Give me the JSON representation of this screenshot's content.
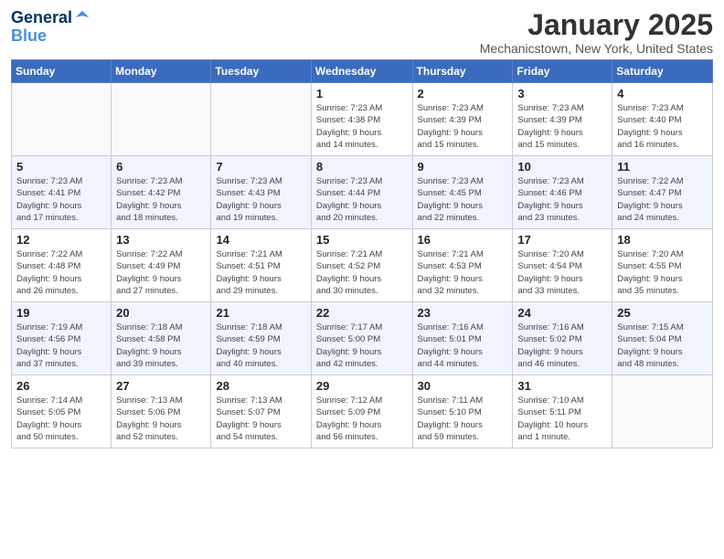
{
  "logo": {
    "line1": "General",
    "line2": "Blue"
  },
  "title": "January 2025",
  "location": "Mechanicstown, New York, United States",
  "weekdays": [
    "Sunday",
    "Monday",
    "Tuesday",
    "Wednesday",
    "Thursday",
    "Friday",
    "Saturday"
  ],
  "weeks": [
    [
      {
        "day": "",
        "info": ""
      },
      {
        "day": "",
        "info": ""
      },
      {
        "day": "",
        "info": ""
      },
      {
        "day": "1",
        "info": "Sunrise: 7:23 AM\nSunset: 4:38 PM\nDaylight: 9 hours\nand 14 minutes."
      },
      {
        "day": "2",
        "info": "Sunrise: 7:23 AM\nSunset: 4:39 PM\nDaylight: 9 hours\nand 15 minutes."
      },
      {
        "day": "3",
        "info": "Sunrise: 7:23 AM\nSunset: 4:39 PM\nDaylight: 9 hours\nand 15 minutes."
      },
      {
        "day": "4",
        "info": "Sunrise: 7:23 AM\nSunset: 4:40 PM\nDaylight: 9 hours\nand 16 minutes."
      }
    ],
    [
      {
        "day": "5",
        "info": "Sunrise: 7:23 AM\nSunset: 4:41 PM\nDaylight: 9 hours\nand 17 minutes."
      },
      {
        "day": "6",
        "info": "Sunrise: 7:23 AM\nSunset: 4:42 PM\nDaylight: 9 hours\nand 18 minutes."
      },
      {
        "day": "7",
        "info": "Sunrise: 7:23 AM\nSunset: 4:43 PM\nDaylight: 9 hours\nand 19 minutes."
      },
      {
        "day": "8",
        "info": "Sunrise: 7:23 AM\nSunset: 4:44 PM\nDaylight: 9 hours\nand 20 minutes."
      },
      {
        "day": "9",
        "info": "Sunrise: 7:23 AM\nSunset: 4:45 PM\nDaylight: 9 hours\nand 22 minutes."
      },
      {
        "day": "10",
        "info": "Sunrise: 7:23 AM\nSunset: 4:46 PM\nDaylight: 9 hours\nand 23 minutes."
      },
      {
        "day": "11",
        "info": "Sunrise: 7:22 AM\nSunset: 4:47 PM\nDaylight: 9 hours\nand 24 minutes."
      }
    ],
    [
      {
        "day": "12",
        "info": "Sunrise: 7:22 AM\nSunset: 4:48 PM\nDaylight: 9 hours\nand 26 minutes."
      },
      {
        "day": "13",
        "info": "Sunrise: 7:22 AM\nSunset: 4:49 PM\nDaylight: 9 hours\nand 27 minutes."
      },
      {
        "day": "14",
        "info": "Sunrise: 7:21 AM\nSunset: 4:51 PM\nDaylight: 9 hours\nand 29 minutes."
      },
      {
        "day": "15",
        "info": "Sunrise: 7:21 AM\nSunset: 4:52 PM\nDaylight: 9 hours\nand 30 minutes."
      },
      {
        "day": "16",
        "info": "Sunrise: 7:21 AM\nSunset: 4:53 PM\nDaylight: 9 hours\nand 32 minutes."
      },
      {
        "day": "17",
        "info": "Sunrise: 7:20 AM\nSunset: 4:54 PM\nDaylight: 9 hours\nand 33 minutes."
      },
      {
        "day": "18",
        "info": "Sunrise: 7:20 AM\nSunset: 4:55 PM\nDaylight: 9 hours\nand 35 minutes."
      }
    ],
    [
      {
        "day": "19",
        "info": "Sunrise: 7:19 AM\nSunset: 4:56 PM\nDaylight: 9 hours\nand 37 minutes."
      },
      {
        "day": "20",
        "info": "Sunrise: 7:18 AM\nSunset: 4:58 PM\nDaylight: 9 hours\nand 39 minutes."
      },
      {
        "day": "21",
        "info": "Sunrise: 7:18 AM\nSunset: 4:59 PM\nDaylight: 9 hours\nand 40 minutes."
      },
      {
        "day": "22",
        "info": "Sunrise: 7:17 AM\nSunset: 5:00 PM\nDaylight: 9 hours\nand 42 minutes."
      },
      {
        "day": "23",
        "info": "Sunrise: 7:16 AM\nSunset: 5:01 PM\nDaylight: 9 hours\nand 44 minutes."
      },
      {
        "day": "24",
        "info": "Sunrise: 7:16 AM\nSunset: 5:02 PM\nDaylight: 9 hours\nand 46 minutes."
      },
      {
        "day": "25",
        "info": "Sunrise: 7:15 AM\nSunset: 5:04 PM\nDaylight: 9 hours\nand 48 minutes."
      }
    ],
    [
      {
        "day": "26",
        "info": "Sunrise: 7:14 AM\nSunset: 5:05 PM\nDaylight: 9 hours\nand 50 minutes."
      },
      {
        "day": "27",
        "info": "Sunrise: 7:13 AM\nSunset: 5:06 PM\nDaylight: 9 hours\nand 52 minutes."
      },
      {
        "day": "28",
        "info": "Sunrise: 7:13 AM\nSunset: 5:07 PM\nDaylight: 9 hours\nand 54 minutes."
      },
      {
        "day": "29",
        "info": "Sunrise: 7:12 AM\nSunset: 5:09 PM\nDaylight: 9 hours\nand 56 minutes."
      },
      {
        "day": "30",
        "info": "Sunrise: 7:11 AM\nSunset: 5:10 PM\nDaylight: 9 hours\nand 59 minutes."
      },
      {
        "day": "31",
        "info": "Sunrise: 7:10 AM\nSunset: 5:11 PM\nDaylight: 10 hours\nand 1 minute."
      },
      {
        "day": "",
        "info": ""
      }
    ]
  ]
}
